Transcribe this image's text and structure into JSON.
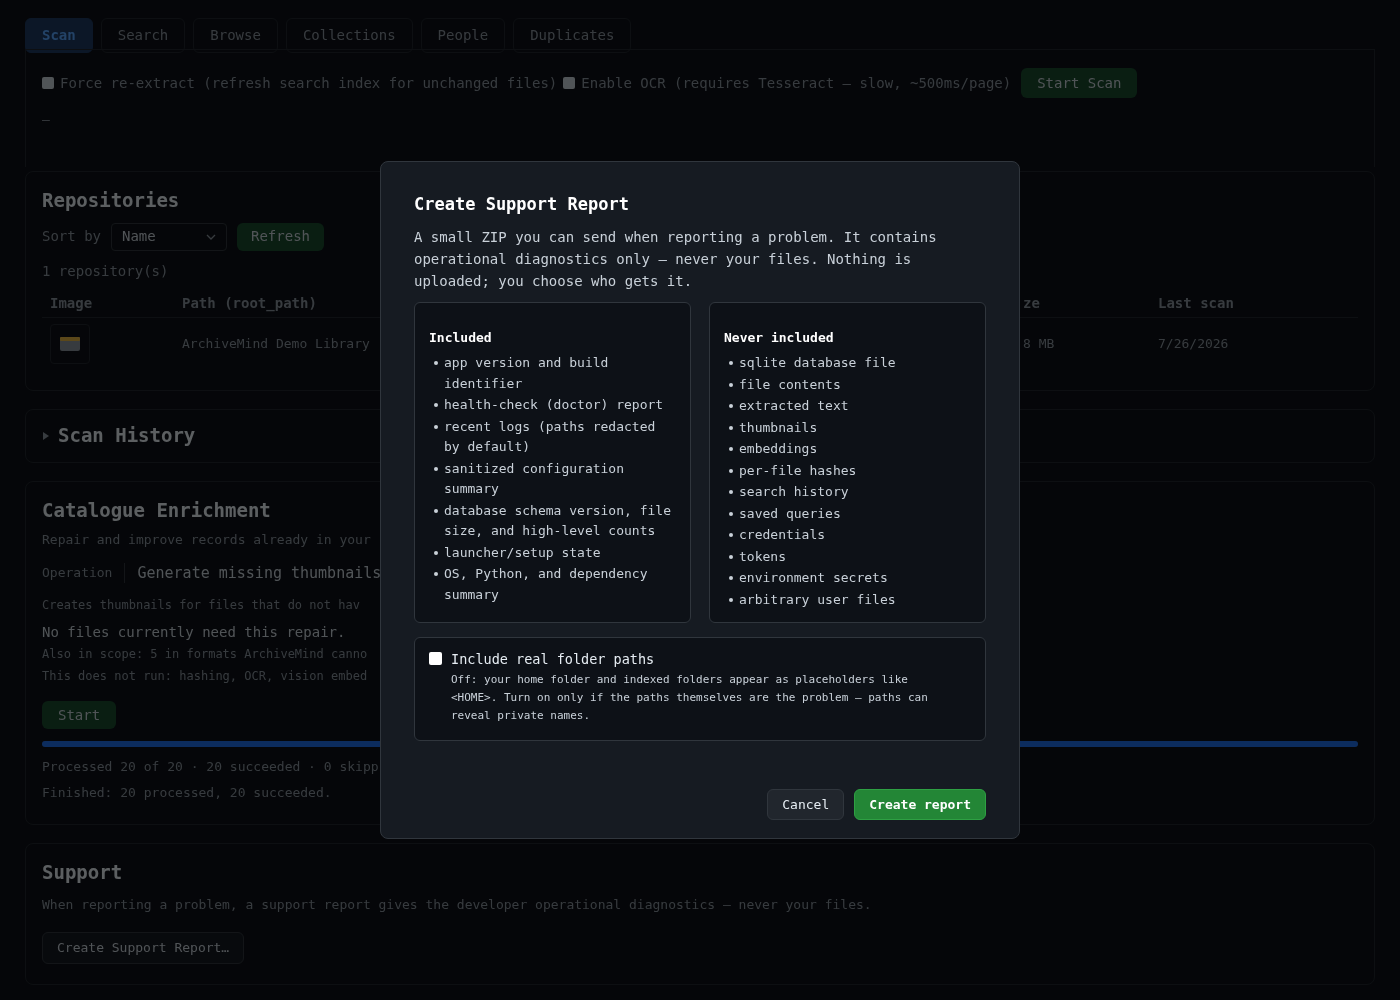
{
  "tabs": [
    {
      "label": "Scan",
      "selected": true
    },
    {
      "label": "Search",
      "selected": false
    },
    {
      "label": "Browse",
      "selected": false
    },
    {
      "label": "Collections",
      "selected": false
    },
    {
      "label": "People",
      "selected": false
    },
    {
      "label": "Duplicates",
      "selected": false
    }
  ],
  "scan_options": [
    {
      "label": "Force re-extract (refresh search index for unchanged files)",
      "checked": false
    },
    {
      "label": "Enable OCR (requires Tesseract — slow, ~500ms/page)",
      "checked": false
    }
  ],
  "start_scan_button": "Start Scan",
  "scan_status": "–",
  "repositories": {
    "title": "Repositories",
    "sort_label": "Sort by",
    "sort_value": "Name",
    "refresh_button": "Refresh",
    "count": "1 repository(s)",
    "columns": [
      "Image",
      "Path (root_path)",
      "ze",
      "Last scan"
    ],
    "rows": [
      {
        "path": "ArchiveMind Demo Library",
        "size": "8 MB",
        "last_scan": "7/26/2026"
      }
    ]
  },
  "scan_history": {
    "title": "Scan History",
    "expanded": false
  },
  "catalogue": {
    "title": "Catalogue Enrichment",
    "description": "Repair and improve records already in your",
    "operation_label": "Operation",
    "operation_value": "Generate missing thumbnails",
    "operation_help": "Creates thumbnails for files that do not hav",
    "notice": "No files currently need this repair.",
    "scope_note": "Also in scope: 5 in formats ArchiveMind canno",
    "exclusions_note": "This does not run: hashing, OCR, vision embed",
    "start_button": "Start",
    "progress": {
      "level": 1.0
    },
    "processed": "Processed 20 of 20 · 20 succeeded · 0 skipp",
    "finished": "Finished: 20 processed, 20 succeeded."
  },
  "support": {
    "title": "Support",
    "description": "When reporting a problem, a support report gives the developer operational diagnostics — never your files.",
    "button": "Create Support Report…"
  },
  "dialog": {
    "title": "Create Support Report",
    "description": "A small ZIP you can send when reporting a problem. It contains operational diagnostics only — never your files. Nothing is uploaded; you choose who gets it.",
    "lists": [
      {
        "title": "Included",
        "items": [
          "app version and build identifier",
          "health-check (doctor) report",
          "recent logs (paths redacted by default)",
          "sanitized configuration summary",
          "database schema version, file size, and high-level counts",
          "launcher/setup state",
          "OS, Python, and dependency summary"
        ]
      },
      {
        "title": "Never included",
        "items": [
          "sqlite database file",
          "file contents",
          "extracted text",
          "thumbnails",
          "embeddings",
          "per-file hashes",
          "search history",
          "saved queries",
          "credentials",
          "tokens",
          "environment secrets",
          "arbitrary user files"
        ]
      }
    ],
    "option": {
      "label": "Include real folder paths",
      "checked": false,
      "help": "Off: your home folder and indexed folders appear as placeholders like <HOME>. Turn on only if the paths themselves are the problem — paths can reveal private names."
    },
    "buttons": [
      {
        "label": "Cancel",
        "kind": "secondary"
      },
      {
        "label": "Create report",
        "kind": "primary"
      }
    ]
  }
}
